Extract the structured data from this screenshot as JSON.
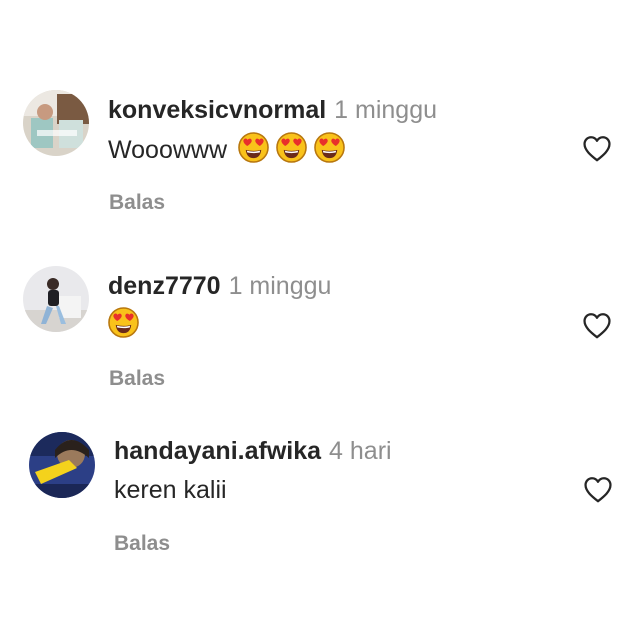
{
  "comments": [
    {
      "username": "konveksicvnormal",
      "time": "1 minggu",
      "text": "Wooowww",
      "emojis": [
        "heart-eyes-emoji",
        "heart-eyes-emoji",
        "heart-eyes-emoji"
      ],
      "reply_label": "Balas",
      "like_icon": "heart-outline-icon"
    },
    {
      "username": "denz7770",
      "time": "1 minggu",
      "text": "",
      "emojis": [
        "heart-eyes-emoji"
      ],
      "reply_label": "Balas",
      "like_icon": "heart-outline-icon"
    },
    {
      "username": "handayani.afwika",
      "time": "4 hari",
      "text": "keren kalii",
      "emojis": [],
      "reply_label": "Balas",
      "like_icon": "heart-outline-icon"
    }
  ],
  "colors": {
    "text": "#262626",
    "secondary": "#8e8e8e",
    "background": "#ffffff"
  }
}
